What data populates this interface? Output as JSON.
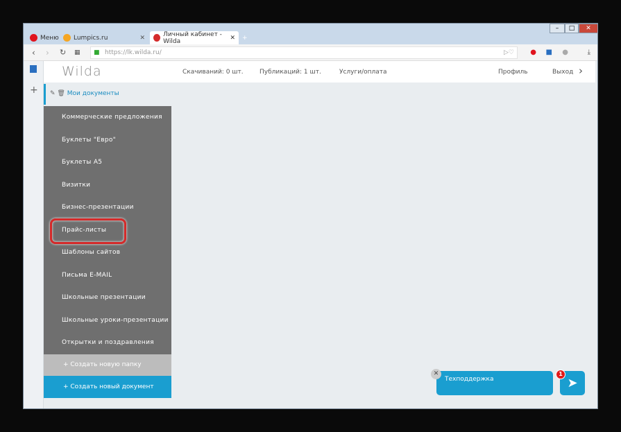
{
  "browser": {
    "tabs": [
      {
        "label": "Меню"
      },
      {
        "label": "Lumpics.ru"
      },
      {
        "label": "Личный кабинет - Wilda"
      }
    ],
    "url": "https://lk.wilda.ru/"
  },
  "header": {
    "logo": "Wilda",
    "downloads": "Скачиваний: 0 шт.",
    "publications": "Публикаций: 1 шт.",
    "services": "Услуги/оплата",
    "profile": "Профиль",
    "logout": "Выход"
  },
  "sidebar": {
    "title": "Мои документы",
    "items": [
      {
        "label": "Коммерческие предложения"
      },
      {
        "label": "Буклеты \"Евро\""
      },
      {
        "label": "Буклеты А5"
      },
      {
        "label": "Визитки"
      },
      {
        "label": "Бизнес-презентации"
      },
      {
        "label": "Прайс-листы"
      },
      {
        "label": "Шаблоны сайтов"
      },
      {
        "label": "Письма E-MAIL"
      },
      {
        "label": "Школьные презентации"
      },
      {
        "label": "Школьные уроки-презентации"
      },
      {
        "label": "Открытки и поздравления"
      }
    ],
    "create_folder": "+ Создать новую папку",
    "create_document": "+ Создать новый документ"
  },
  "support": {
    "label": "Техподдержка",
    "badge": "1"
  },
  "colors": {
    "accent": "#1a9ed0",
    "highlight": "#d42a2a",
    "menu_bg": "#6f6f6f"
  }
}
